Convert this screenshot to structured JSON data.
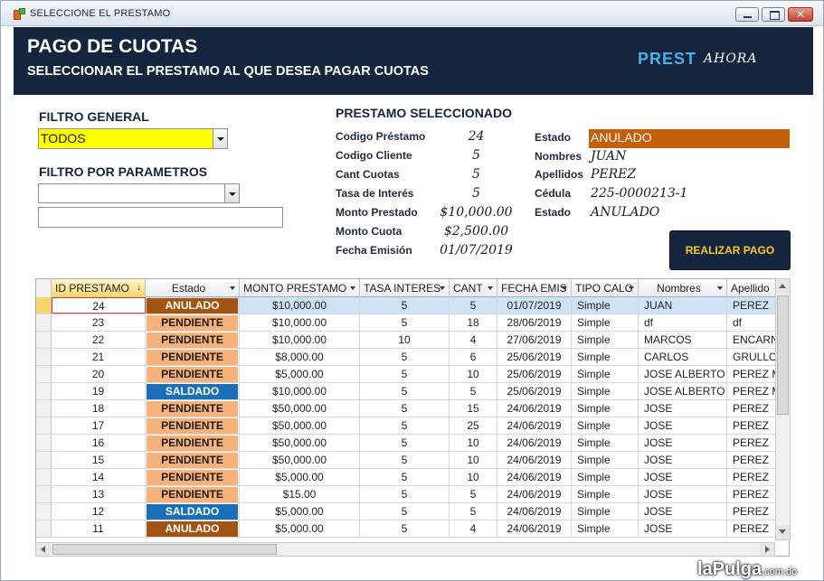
{
  "window": {
    "title": "SELECCIONE EL PRESTAMO"
  },
  "header": {
    "title": "PAGO DE CUOTAS",
    "subtitle": "SELECCIONAR EL PRESTAMO AL QUE DESEA PAGAR CUOTAS",
    "brand_main": "PREST",
    "brand_sub": "AHORA"
  },
  "filters": {
    "general_label": "FILTRO GENERAL",
    "general_value": "TODOS",
    "params_label": "FILTRO POR PARAMETROS",
    "params_value": "",
    "params_text": ""
  },
  "selected": {
    "section_label": "PRESTAMO SELECCIONADO",
    "fields_left": [
      {
        "label": "Codigo Préstamo",
        "value": "24"
      },
      {
        "label": "Codigo Cliente",
        "value": "5"
      },
      {
        "label": "Cant Cuotas",
        "value": "5"
      },
      {
        "label": "Tasa de Interés",
        "value": "5"
      },
      {
        "label": "Monto Prestado",
        "value": "$10,000.00"
      },
      {
        "label": "Monto Cuota",
        "value": "$2,500.00"
      },
      {
        "label": "Fecha Emisión",
        "value": "01/07/2019"
      }
    ],
    "fields_right": [
      {
        "label": "Estado",
        "value": "ANULADO"
      },
      {
        "label": "Nombres",
        "value": "JUAN"
      },
      {
        "label": "Apellidos",
        "value": "PEREZ"
      },
      {
        "label": "Cédula",
        "value": "225-0000213-1"
      },
      {
        "label": "Estado",
        "value": "ANULADO"
      }
    ],
    "pay_button": "REALIZAR PAGO"
  },
  "grid": {
    "columns": [
      "ID PRESTAMO",
      "Estado",
      "MONTO PRESTAMO",
      "TASA INTERES",
      "CANT",
      "FECHA EMIS",
      "TIPO CALC",
      "Nombres",
      "Apellido"
    ],
    "rows": [
      [
        "24",
        "ANULADO",
        "$10,000.00",
        "5",
        "5",
        "01/07/2019",
        "Simple",
        "JUAN",
        "PEREZ"
      ],
      [
        "23",
        "PENDIENTE",
        "$10,000.00",
        "5",
        "18",
        "28/06/2019",
        "Simple",
        "df",
        "df"
      ],
      [
        "22",
        "PENDIENTE",
        "$10,000.00",
        "10",
        "4",
        "27/06/2019",
        "Simple",
        "MARCOS",
        "ENCARNA"
      ],
      [
        "21",
        "PENDIENTE",
        "$8,000.00",
        "5",
        "6",
        "25/06/2019",
        "Simple",
        "CARLOS",
        "GRULLON"
      ],
      [
        "20",
        "PENDIENTE",
        "$5,000.00",
        "5",
        "10",
        "25/06/2019",
        "Simple",
        "JOSE ALBERTO",
        "PEREZ MA"
      ],
      [
        "19",
        "SALDADO",
        "$10,000.00",
        "5",
        "5",
        "25/06/2019",
        "Simple",
        "JOSE ALBERTO",
        "PEREZ MA"
      ],
      [
        "18",
        "PENDIENTE",
        "$50,000.00",
        "5",
        "15",
        "24/06/2019",
        "Simple",
        "JOSE",
        "PEREZ"
      ],
      [
        "17",
        "PENDIENTE",
        "$50,000.00",
        "5",
        "25",
        "24/06/2019",
        "Simple",
        "JOSE",
        "PEREZ"
      ],
      [
        "16",
        "PENDIENTE",
        "$50,000.00",
        "5",
        "10",
        "24/06/2019",
        "Simple",
        "JOSE",
        "PEREZ"
      ],
      [
        "15",
        "PENDIENTE",
        "$50,000.00",
        "5",
        "10",
        "24/06/2019",
        "Simple",
        "JOSE",
        "PEREZ"
      ],
      [
        "14",
        "PENDIENTE",
        "$5,000.00",
        "5",
        "10",
        "24/06/2019",
        "Simple",
        "JOSE",
        "PEREZ"
      ],
      [
        "13",
        "PENDIENTE",
        "$15.00",
        "5",
        "5",
        "24/06/2019",
        "Simple",
        "JOSE",
        "PEREZ"
      ],
      [
        "12",
        "SALDADO",
        "$5,000.00",
        "5",
        "5",
        "24/06/2019",
        "Simple",
        "JOSE",
        "PEREZ"
      ],
      [
        "11",
        "ANULADO",
        "$5,000.00",
        "5",
        "4",
        "24/06/2019",
        "Simple",
        "JOSE",
        "PEREZ"
      ]
    ]
  },
  "watermark": {
    "main": "laPulga",
    "domain": ".com.do"
  },
  "colors": {
    "header_bg": "#15253d",
    "pendiente": "#f7b27a",
    "anulado": "#a35412",
    "saldado": "#1a6fb8",
    "filter_yellow": "#ffff00",
    "estado_orange": "#c65f0b"
  }
}
